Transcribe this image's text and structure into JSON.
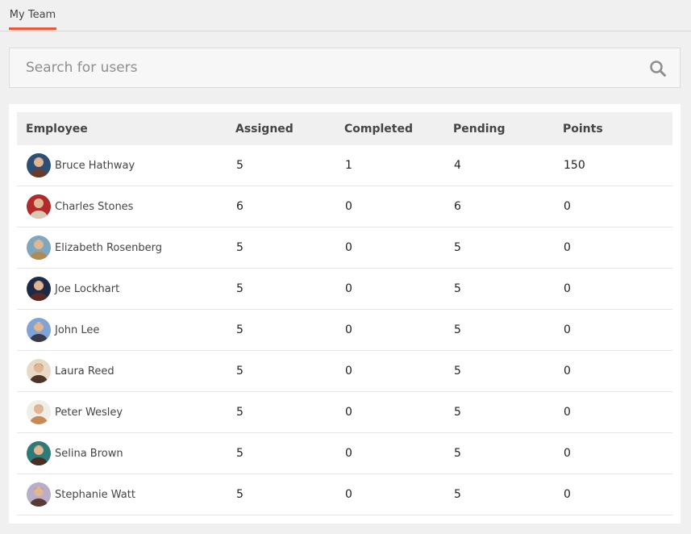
{
  "tabs": [
    {
      "label": "My Team"
    }
  ],
  "search": {
    "placeholder": "Search for users",
    "value": ""
  },
  "table": {
    "columns": [
      "Employee",
      "Assigned",
      "Completed",
      "Pending",
      "Points"
    ],
    "rows": [
      {
        "name": "Bruce Hathway",
        "assigned": "5",
        "completed": "1",
        "pending": "4",
        "points": "150",
        "avatar_colors": [
          "#6a3a2a",
          "#2d4f73"
        ]
      },
      {
        "name": "Charles Stones",
        "assigned": "6",
        "completed": "0",
        "pending": "6",
        "points": "0",
        "avatar_colors": [
          "#d8c9b5",
          "#b22a2a"
        ]
      },
      {
        "name": "Elizabeth Rosenberg",
        "assigned": "5",
        "completed": "0",
        "pending": "5",
        "points": "0",
        "avatar_colors": [
          "#b08a55",
          "#7fa6bf"
        ]
      },
      {
        "name": "Joe Lockhart",
        "assigned": "5",
        "completed": "0",
        "pending": "5",
        "points": "0",
        "avatar_colors": [
          "#5a2a22",
          "#1e2a44"
        ]
      },
      {
        "name": "John Lee",
        "assigned": "5",
        "completed": "0",
        "pending": "5",
        "points": "0",
        "avatar_colors": [
          "#3a3a48",
          "#7fa3d6"
        ]
      },
      {
        "name": "Laura Reed",
        "assigned": "5",
        "completed": "0",
        "pending": "5",
        "points": "0",
        "avatar_colors": [
          "#4a3526",
          "#e7d9c6"
        ]
      },
      {
        "name": "Peter Wesley",
        "assigned": "5",
        "completed": "0",
        "pending": "5",
        "points": "0",
        "avatar_colors": [
          "#c68a55",
          "#f1eee8"
        ]
      },
      {
        "name": "Selina Brown",
        "assigned": "5",
        "completed": "0",
        "pending": "5",
        "points": "0",
        "avatar_colors": [
          "#4a2e24",
          "#2e7a78"
        ]
      },
      {
        "name": "Stephanie Watt",
        "assigned": "5",
        "completed": "0",
        "pending": "5",
        "points": "0",
        "avatar_colors": [
          "#5a3a33",
          "#b9aec7"
        ]
      }
    ]
  },
  "colors": {
    "accent": "#e8583a",
    "header_bg": "#f0f0f0"
  }
}
